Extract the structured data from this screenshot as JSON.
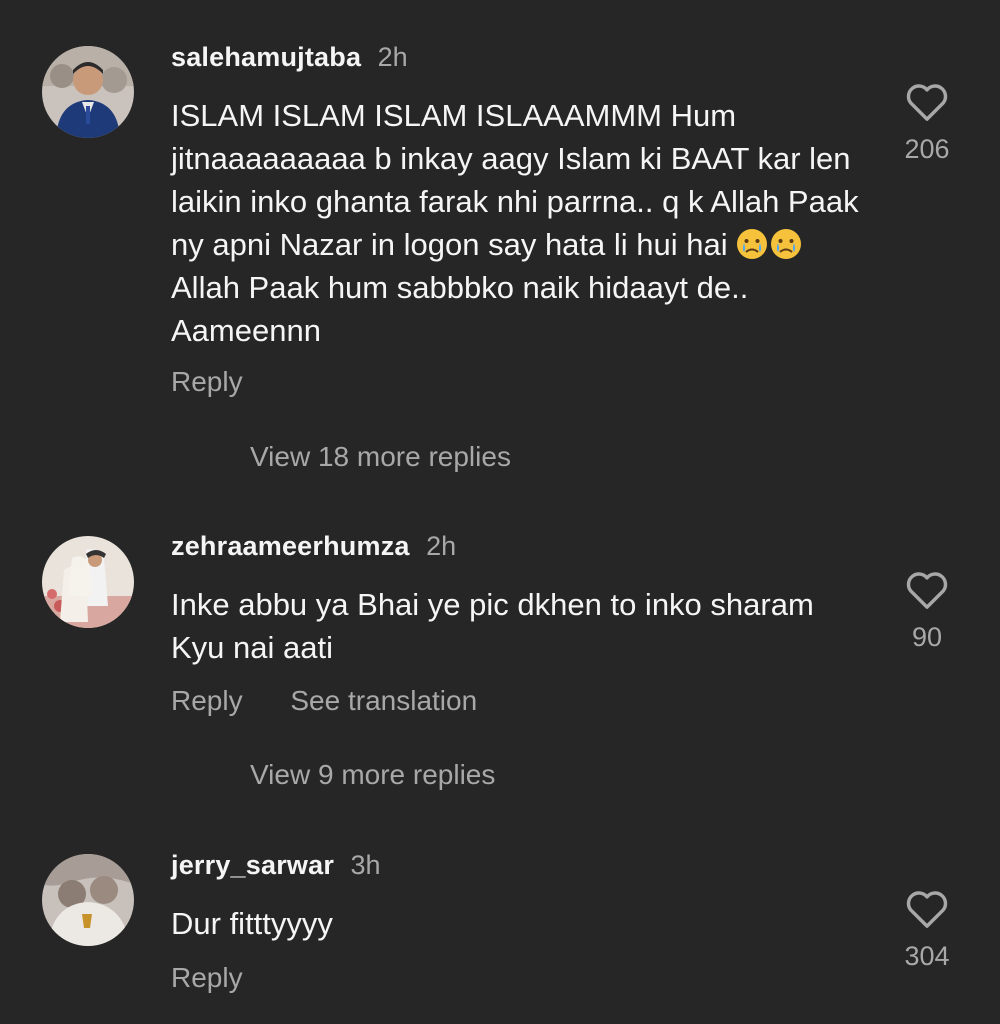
{
  "comments": [
    {
      "username": "salehamujtaba",
      "time": "2h",
      "text_before_emoji": "ISLAM ISLAM ISLAM ISLAAAMMM Hum jitnaaaaaaaaa b inkay aagy Islam ki BAAT kar len laikin inko ghanta farak nhi parrna.. q k Allah Paak ny apni Nazar in logon say hata li hui hai ",
      "text_after_emoji": " Allah Paak hum sabbbko naik hidaayt de.. Aameennn",
      "emoji": [
        "crying-face-emoji",
        "crying-face-emoji"
      ],
      "reply_label": "Reply",
      "likes": "206",
      "view_more": "View 18 more replies"
    },
    {
      "username": "zehraameerhumza",
      "time": "2h",
      "text": "Inke abbu ya Bhai ye pic dkhen to inko sharam Kyu nai aati",
      "reply_label": "Reply",
      "translate_label": "See translation",
      "likes": "90",
      "view_more": "View 9 more replies"
    },
    {
      "username": "jerry_sarwar",
      "time": "3h",
      "text": "Dur fitttyyyy",
      "reply_label": "Reply",
      "likes": "304"
    }
  ],
  "colors": {
    "background": "#262626",
    "primary_text": "#f5f5f5",
    "secondary_text": "#a8a8a8"
  },
  "icons": {
    "like": "heart-outline-icon"
  }
}
